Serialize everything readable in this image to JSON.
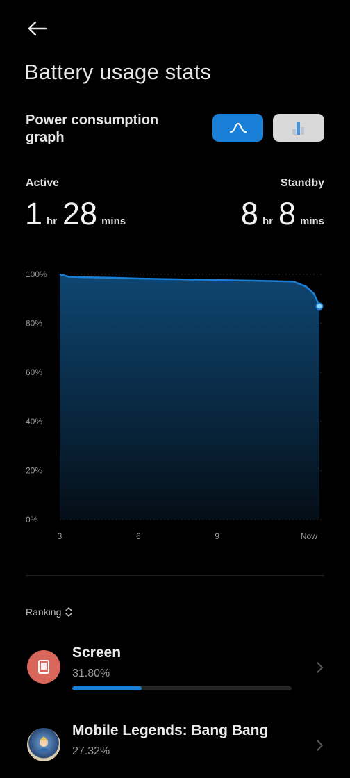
{
  "header": {
    "title": "Battery usage stats"
  },
  "graph_section": {
    "title": "Power consumption graph",
    "toggle_selected": "line"
  },
  "active": {
    "label": "Active",
    "hours": "1",
    "hours_unit": "hr",
    "mins": "28",
    "mins_unit": "mins"
  },
  "standby": {
    "label": "Standby",
    "hours": "8",
    "hours_unit": "hr",
    "mins": "8",
    "mins_unit": "mins"
  },
  "colors": {
    "accent": "#1a7fd6",
    "background": "#000000",
    "screen_icon": "#d8665a"
  },
  "chart_data": {
    "type": "area",
    "y_ticks": [
      "100%",
      "80%",
      "60%",
      "40%",
      "20%",
      "0%"
    ],
    "x_ticks": [
      {
        "label": "3",
        "x": 3
      },
      {
        "label": "6",
        "x": 6
      },
      {
        "label": "9",
        "x": 9
      },
      {
        "label": "Now",
        "x": 12.5
      }
    ],
    "ylim": [
      0,
      100
    ],
    "xlim": [
      3,
      12.9
    ],
    "grid": true,
    "series": [
      {
        "x": [
          3,
          3.35,
          4,
          5,
          6,
          7,
          8,
          9,
          10,
          11,
          11.9,
          12.4,
          12.7,
          12.9
        ],
        "y": [
          100,
          99,
          98.8,
          98.6,
          98.3,
          98.1,
          97.9,
          97.7,
          97.5,
          97.3,
          97.1,
          95,
          92,
          87
        ]
      }
    ]
  },
  "ranking": {
    "label": "Ranking"
  },
  "apps": [
    {
      "name": "Screen",
      "percent": "31.80%",
      "value": 0.318,
      "icon": "tablet-icon"
    },
    {
      "name": "Mobile Legends: Bang Bang",
      "percent": "27.32%",
      "value": 0.2732,
      "icon": "game-avatar-icon"
    }
  ]
}
